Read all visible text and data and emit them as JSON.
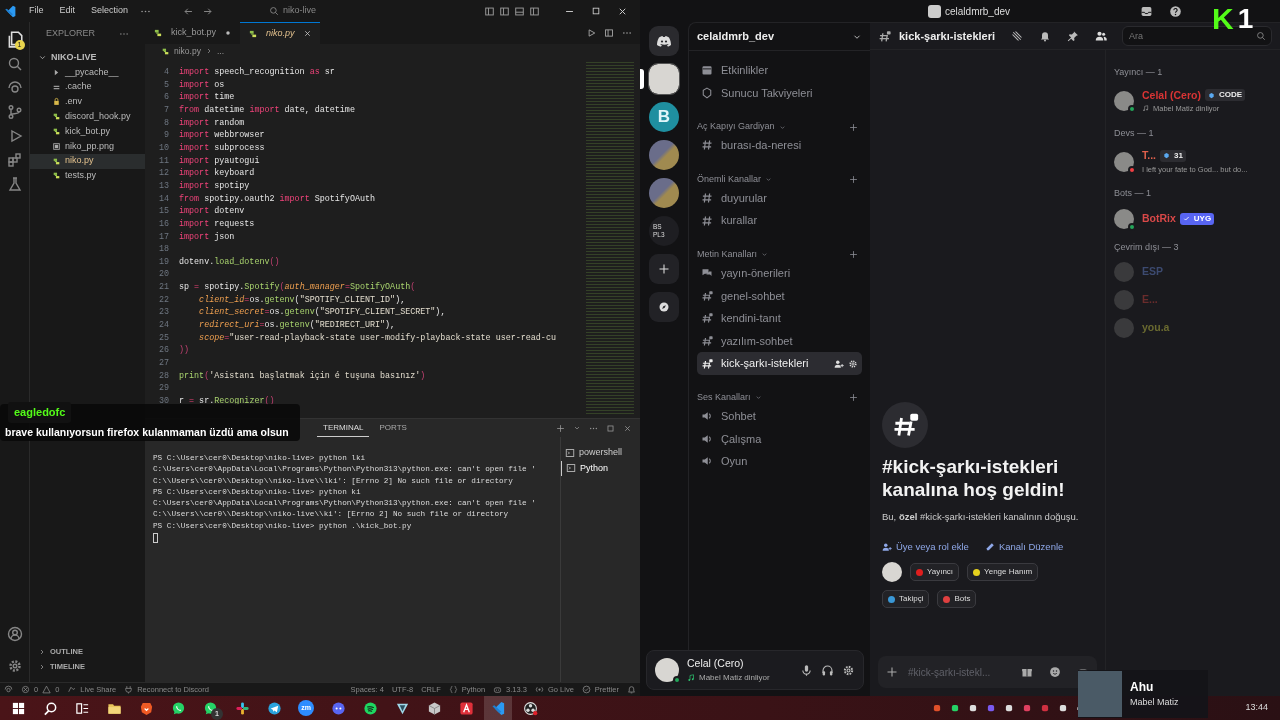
{
  "vscode": {
    "menu": [
      "File",
      "Edit",
      "Selection"
    ],
    "command_center": "niko-live",
    "explorer": {
      "title": "EXPLORER",
      "root": "NIKO-LIVE",
      "badge": "1",
      "files": [
        {
          "name": "__pycache__",
          "kind": "folder",
          "selected": false
        },
        {
          "name": ".cache",
          "kind": "plain",
          "selected": false
        },
        {
          "name": ".env",
          "kind": "lock",
          "selected": false
        },
        {
          "name": "discord_hook.py",
          "kind": "python",
          "selected": false
        },
        {
          "name": "kick_bot.py",
          "kind": "python",
          "selected": false
        },
        {
          "name": "niko_pp.png",
          "kind": "image",
          "selected": false
        },
        {
          "name": "niko.py",
          "kind": "python",
          "selected": true
        },
        {
          "name": "tests.py",
          "kind": "python",
          "selected": false
        }
      ],
      "sections": [
        "OUTLINE",
        "TIMELINE"
      ]
    },
    "tabs": [
      {
        "label": "kick_bot.py",
        "selected": false,
        "modified": true
      },
      {
        "label": "niko.py",
        "selected": true,
        "modified": false
      }
    ],
    "breadcrumb": [
      "niko.py",
      "..."
    ],
    "code": [
      {
        "n": "4",
        "t": [
          {
            "kind": "kw",
            "text": "import"
          },
          {
            "kind": "id",
            "text": " speech_recognition "
          },
          {
            "kind": "kw",
            "text": "as"
          },
          {
            "kind": "id",
            "text": " sr"
          }
        ]
      },
      {
        "n": "5",
        "t": [
          {
            "kind": "kw",
            "text": "import"
          },
          {
            "kind": "id",
            "text": " os"
          }
        ]
      },
      {
        "n": "6",
        "t": [
          {
            "kind": "kw",
            "text": "import"
          },
          {
            "kind": "id",
            "text": " time"
          }
        ]
      },
      {
        "n": "7",
        "t": [
          {
            "kind": "kw",
            "text": "from"
          },
          {
            "kind": "id",
            "text": " datetime "
          },
          {
            "kind": "kw",
            "text": "import"
          },
          {
            "kind": "id",
            "text": " date, datetime"
          }
        ]
      },
      {
        "n": "8",
        "t": [
          {
            "kind": "kw",
            "text": "import"
          },
          {
            "kind": "id",
            "text": " random"
          }
        ]
      },
      {
        "n": "9",
        "t": [
          {
            "kind": "kw",
            "text": "import"
          },
          {
            "kind": "id",
            "text": " webbrowser"
          }
        ]
      },
      {
        "n": "10",
        "t": [
          {
            "kind": "kw",
            "text": "import"
          },
          {
            "kind": "id",
            "text": " subprocess"
          }
        ]
      },
      {
        "n": "11",
        "t": [
          {
            "kind": "kw",
            "text": "import"
          },
          {
            "kind": "id",
            "text": " pyautogui"
          }
        ]
      },
      {
        "n": "12",
        "t": [
          {
            "kind": "kw",
            "text": "import"
          },
          {
            "kind": "id",
            "text": " keyboard"
          }
        ]
      },
      {
        "n": "13",
        "t": [
          {
            "kind": "kw",
            "text": "import"
          },
          {
            "kind": "id",
            "text": " spotipy"
          }
        ]
      },
      {
        "n": "14",
        "t": [
          {
            "kind": "kw",
            "text": "from"
          },
          {
            "kind": "id",
            "text": " spotipy.oauth2 "
          },
          {
            "kind": "kw",
            "text": "import"
          },
          {
            "kind": "id",
            "text": " SpotifyOAuth"
          }
        ]
      },
      {
        "n": "15",
        "t": [
          {
            "kind": "kw",
            "text": "import"
          },
          {
            "kind": "id",
            "text": " dotenv"
          }
        ]
      },
      {
        "n": "16",
        "t": [
          {
            "kind": "kw",
            "text": "import"
          },
          {
            "kind": "id",
            "text": " requests"
          }
        ]
      },
      {
        "n": "17",
        "t": [
          {
            "kind": "kw",
            "text": "import"
          },
          {
            "kind": "id",
            "text": " json"
          }
        ]
      },
      {
        "n": "18"
      },
      {
        "n": "19",
        "t": [
          {
            "kind": "id",
            "text": "dotenv."
          },
          {
            "kind": "fn",
            "text": "load_dotenv"
          },
          {
            "kind": "p",
            "text": "()"
          }
        ]
      },
      {
        "n": "20"
      },
      {
        "n": "21",
        "t": [
          {
            "kind": "id",
            "text": "sp "
          },
          {
            "kind": "op",
            "text": "="
          },
          {
            "kind": "id",
            "text": " spotipy."
          },
          {
            "kind": "fn",
            "text": "Spotify"
          },
          {
            "kind": "p",
            "text": "("
          },
          {
            "kind": "param",
            "text": "auth_manager"
          },
          {
            "kind": "op",
            "text": "="
          },
          {
            "kind": "fn",
            "text": "SpotifyOAuth"
          },
          {
            "kind": "p",
            "text": "("
          }
        ]
      },
      {
        "n": "22",
        "t": [
          {
            "kind": "param",
            "text": "    client_id"
          },
          {
            "kind": "op",
            "text": "="
          },
          {
            "kind": "id",
            "text": "os."
          },
          {
            "kind": "fn",
            "text": "getenv"
          },
          {
            "kind": "id",
            "text": "("
          },
          {
            "kind": "str",
            "text": "\"SPOTIFY_CLIENT_ID\""
          },
          {
            "kind": "id",
            "text": "),"
          }
        ]
      },
      {
        "n": "23",
        "t": [
          {
            "kind": "param",
            "text": "    client_secret"
          },
          {
            "kind": "op",
            "text": "="
          },
          {
            "kind": "id",
            "text": "os."
          },
          {
            "kind": "fn",
            "text": "getenv"
          },
          {
            "kind": "id",
            "text": "("
          },
          {
            "kind": "str",
            "text": "\"SPOTIFY_CLIENT_SECRET\""
          },
          {
            "kind": "id",
            "text": "),"
          }
        ]
      },
      {
        "n": "24",
        "t": [
          {
            "kind": "param",
            "text": "    redirect_uri"
          },
          {
            "kind": "op",
            "text": "="
          },
          {
            "kind": "id",
            "text": "os."
          },
          {
            "kind": "fn",
            "text": "getenv"
          },
          {
            "kind": "id",
            "text": "("
          },
          {
            "kind": "str",
            "text": "\"REDIRECT_URI\""
          },
          {
            "kind": "id",
            "text": "),"
          }
        ]
      },
      {
        "n": "25",
        "t": [
          {
            "kind": "param",
            "text": "    scope"
          },
          {
            "kind": "op",
            "text": "="
          },
          {
            "kind": "str",
            "text": "\"user-read-playback-state user-modify-playback-state user-read-cu"
          }
        ]
      },
      {
        "n": "26",
        "t": [
          {
            "kind": "p",
            "text": "))"
          }
        ]
      },
      {
        "n": "27"
      },
      {
        "n": "28",
        "t": [
          {
            "kind": "fn",
            "text": "print"
          },
          {
            "kind": "p",
            "text": "("
          },
          {
            "kind": "str",
            "text": "'Asistanı başlatmak için é tuşuna basınız'"
          },
          {
            "kind": "p",
            "text": ")"
          }
        ]
      },
      {
        "n": "29"
      },
      {
        "n": "30",
        "t": [
          {
            "kind": "id",
            "text": "r "
          },
          {
            "kind": "op",
            "text": "="
          },
          {
            "kind": "id",
            "text": " sr."
          },
          {
            "kind": "fn",
            "text": "Recognizer"
          },
          {
            "kind": "p",
            "text": "()"
          }
        ]
      }
    ],
    "panel_tabs": [
      {
        "label": "TERMINAL",
        "selected": true
      },
      {
        "label": "PORTS",
        "selected": false
      }
    ],
    "terminal": [
      "PS C:\\Users\\cer0\\Desktop\\niko-live> python lki",
      "C:\\Users\\cer0\\AppData\\Local\\Programs\\Python\\Python313\\python.exe: can't open file '",
      "C:\\\\Users\\\\cer0\\\\Desktop\\\\niko-live\\\\lki': [Errno 2] No such file or directory",
      "PS C:\\Users\\cer0\\Desktop\\niko-live> python ki",
      "C:\\Users\\cer0\\AppData\\Local\\Programs\\Python\\Python313\\python.exe: can't open file '",
      "C:\\\\Users\\\\cer0\\\\Desktop\\\\niko-live\\\\ki': [Errno 2] No such file or directory",
      "PS C:\\Users\\cer0\\Desktop\\niko-live> python .\\kick_bot.py"
    ],
    "terminals": [
      {
        "label": "powershell",
        "selected": false
      },
      {
        "label": "Python",
        "selected": true
      }
    ],
    "status_left": [
      {
        "kind": "remote"
      },
      {
        "kind": "problems",
        "errors": "0",
        "warnings": "0"
      },
      {
        "kind": "liveshare",
        "text": "Live Share"
      },
      {
        "kind": "discord",
        "text": "Reconnect to Discord"
      }
    ],
    "status_right": [
      {
        "kind": "text",
        "text": "Spaces: 4"
      },
      {
        "kind": "text",
        "text": "UTF-8"
      },
      {
        "kind": "text",
        "text": "CRLF"
      },
      {
        "kind": "language",
        "text": "Python"
      },
      {
        "kind": "version",
        "text": "3.13.3"
      },
      {
        "kind": "golive",
        "text": "Go Live"
      },
      {
        "kind": "prettier",
        "text": "Prettier"
      },
      {
        "kind": "bell"
      }
    ]
  },
  "discord": {
    "window_title": "celaldmrb_dev",
    "server_name": "celaldmrb_dev",
    "servers": [
      {
        "kind": "photo",
        "selected": true
      },
      {
        "kind": "logo",
        "label": "B",
        "selected": false
      },
      {
        "kind": "folder",
        "selected": false
      },
      {
        "kind": "folder",
        "selected": false
      },
      {
        "kind": "text-folder",
        "labels": [
          "BS",
          "PL3"
        ],
        "selected": false
      }
    ],
    "links": [
      {
        "kind": "events",
        "label": "Etkinlikler"
      },
      {
        "kind": "boosts",
        "label": "Sunucu Takviyeleri"
      }
    ],
    "categories": [
      {
        "name": "Aç Kapıyı Gardiyan",
        "channels": [
          {
            "kind": "text",
            "name": "burası-da-neresi",
            "selected": false
          }
        ]
      },
      {
        "name": "Önemli Kanallar",
        "channels": [
          {
            "kind": "text",
            "name": "duyurular",
            "selected": false
          },
          {
            "kind": "text",
            "name": "kurallar",
            "selected": false
          }
        ]
      },
      {
        "name": "Metin Kanalları",
        "channels": [
          {
            "kind": "forum",
            "name": "yayın-önerileri",
            "selected": false
          },
          {
            "kind": "private",
            "name": "genel-sohbet",
            "selected": false
          },
          {
            "kind": "private",
            "name": "kendini-tanıt",
            "selected": false
          },
          {
            "kind": "private",
            "name": "yazılım-sohbet",
            "selected": false
          },
          {
            "kind": "private",
            "name": "kick-şarkı-istekleri",
            "selected": true
          }
        ]
      },
      {
        "name": "Ses Kanalları",
        "channels": [
          {
            "kind": "voice",
            "name": "Sohbet",
            "selected": false
          },
          {
            "kind": "voice",
            "name": "Çalışma",
            "selected": false
          },
          {
            "kind": "voice",
            "name": "Oyun",
            "selected": false
          }
        ]
      }
    ],
    "user": {
      "name": "Celal (Cero)",
      "activity": "Mabel Matiz dinliyor",
      "kind": "online"
    },
    "channel_title": "kick-şarkı-istekleri",
    "search": {
      "placeholder": "Ara"
    },
    "welcome": {
      "heading": "#kick-şarkı-istekleri kanalına hoş geldin!",
      "text": "Bu, **özel** #kick-şarkı-istekleri kanalının doğuşu.",
      "actions": [
        {
          "kind": "add-member",
          "label": "Üye veya rol ekle"
        },
        {
          "kind": "edit",
          "label": "Kanalı Düzenle"
        }
      ],
      "roles": [
        {
          "name": "Yayıncı",
          "color": "#e01e1e"
        },
        {
          "name": "Yenge Hanım",
          "color": "#e6d21e"
        },
        {
          "name": "Takipçi",
          "color": "#3a98d6"
        },
        {
          "name": "Bots",
          "color": "#e04040"
        }
      ]
    },
    "input": {
      "placeholder": "#kick-şarkı-istekl..."
    },
    "member_groups": [
      {
        "title": "Yayıncı — 1",
        "members": [
          {
            "name": "Celal (Cero)",
            "color": "#d83434",
            "kind": "online",
            "tag": {
              "kind": "guild",
              "text": "CODE"
            },
            "activity": {
              "kind": "music",
              "text": "Mabel Matiz dinliyor"
            }
          }
        ]
      },
      {
        "title": "Devs — 1",
        "members": [
          {
            "name": "T...",
            "color": "#e0604c",
            "kind": "dnd",
            "tag": {
              "kind": "guild",
              "text": "31"
            },
            "activity": {
              "kind": "custom",
              "text": "I left your fate to God... but do..."
            }
          }
        ]
      },
      {
        "title": "Bots — 1",
        "members": [
          {
            "name": "BotRix",
            "color": "#d84848",
            "kind": "online",
            "tag": {
              "kind": "app",
              "text": "UYG"
            }
          }
        ]
      },
      {
        "title": "Çevrim dışı — 3",
        "members": [
          {
            "name": "ESP",
            "color": "#3c4a70",
            "kind": "offline"
          },
          {
            "name": "E...",
            "color": "#6a2c2c",
            "kind": "offline"
          },
          {
            "name": "you.a",
            "color": "#6a6a30",
            "kind": "offline"
          }
        ]
      }
    ]
  },
  "chat_overlay": {
    "user": "eagledofc",
    "message": "brave kullanıyorsun firefox kulanmaman üzdü ama olsun"
  },
  "kick_overlay": {
    "logo": "K",
    "count": "1"
  },
  "now_playing": {
    "title": "Ahu",
    "artist": "Mabel Matiz"
  },
  "taskbar": {
    "apps": [
      {
        "kind": "start",
        "selected": false
      },
      {
        "kind": "search",
        "selected": false
      },
      {
        "kind": "taskview",
        "selected": false
      },
      {
        "kind": "folder",
        "selected": false
      },
      {
        "kind": "lion",
        "selected": false
      },
      {
        "kind": "chat",
        "selected": false
      },
      {
        "kind": "chat",
        "badge": "1",
        "selected": false
      },
      {
        "kind": "pinwheel",
        "selected": false
      },
      {
        "kind": "plane",
        "selected": false
      },
      {
        "kind": "label",
        "label": "zm",
        "selected": false
      },
      {
        "kind": "controller",
        "selected": false
      },
      {
        "kind": "waves",
        "selected": false
      },
      {
        "kind": "triangle",
        "selected": false
      },
      {
        "kind": "cube",
        "selected": false
      },
      {
        "kind": "tile",
        "selected": false
      },
      {
        "kind": "editor",
        "selected": true
      },
      {
        "kind": "record",
        "selected": false
      }
    ],
    "clock": "13:44"
  }
}
